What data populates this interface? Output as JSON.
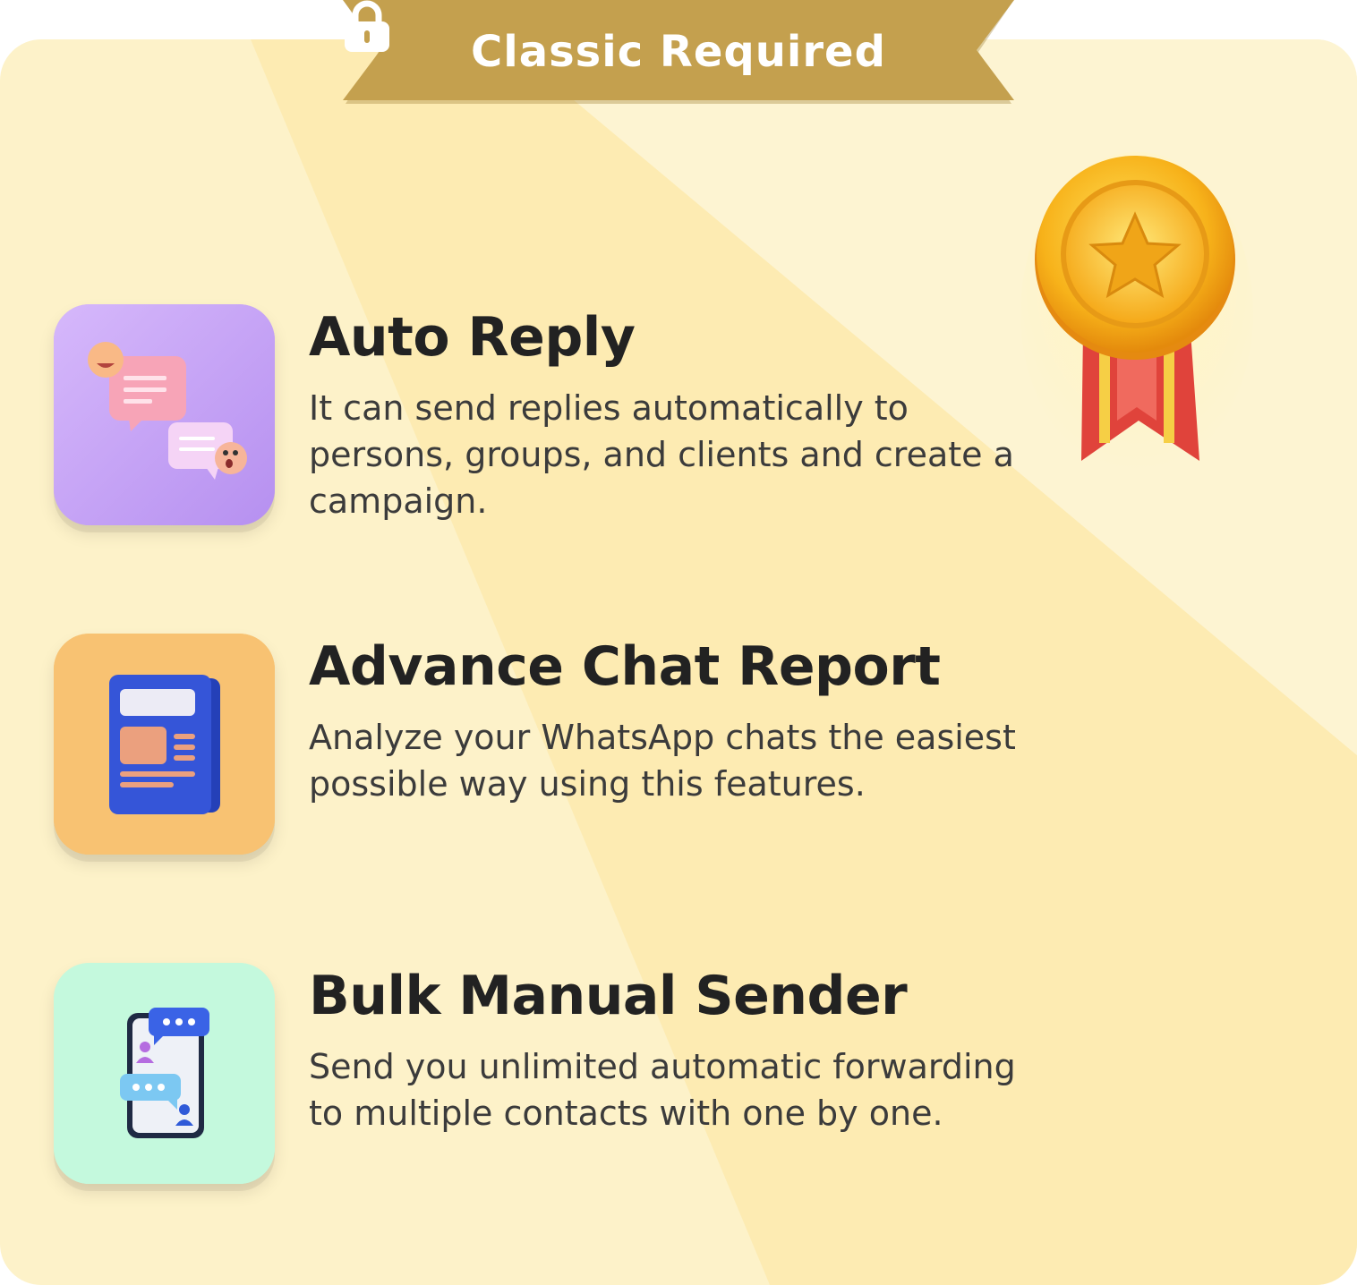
{
  "banner": {
    "icon": "lock-icon",
    "title": "Classic  Required",
    "color": "#c4a04e"
  },
  "medal": {
    "icon": "gold-medal-icon"
  },
  "features": [
    {
      "title": "Auto Reply",
      "description": "It can send replies automatically to persons, groups, and clients and create a campaign.",
      "icon": "chat-bubbles-emoji-icon",
      "tile_color": "#c9a7f5"
    },
    {
      "title": "Advance Chat Report",
      "description": "Analyze your WhatsApp chats the easiest possible way using this features.",
      "icon": "report-document-icon",
      "tile_color": "#f8c272"
    },
    {
      "title": "Bulk Manual Sender",
      "description": "Send you unlimited automatic forwarding to multiple contacts with one by one.",
      "icon": "phone-chat-contacts-icon",
      "tile_color": "#c4f9dd"
    }
  ]
}
